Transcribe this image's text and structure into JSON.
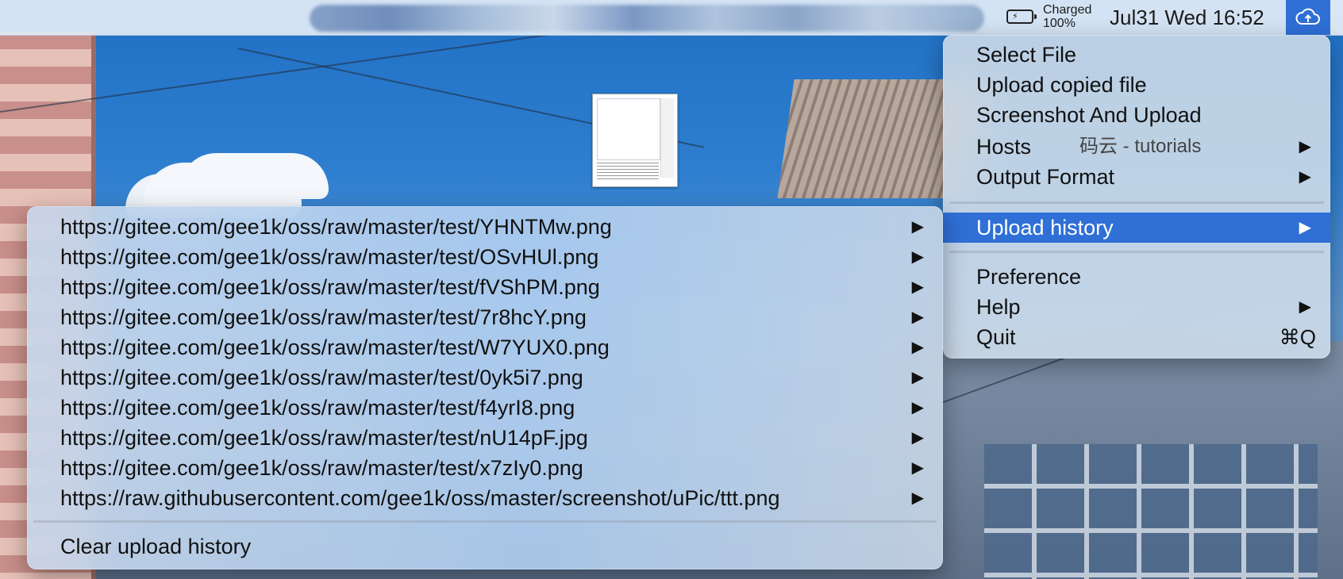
{
  "menubar": {
    "battery_status": "Charged",
    "battery_percent": "100%",
    "clock": "Jul31 Wed 16:52",
    "tray_icon": "cloud-upload-icon"
  },
  "main_menu": {
    "items": [
      {
        "label": "Select File"
      },
      {
        "label": "Upload copied file"
      },
      {
        "label": "Screenshot And Upload"
      },
      {
        "label": "Hosts",
        "value": "码云 - tutorials",
        "has_submenu": true
      },
      {
        "label": "Output Format",
        "has_submenu": true
      },
      {
        "label": "Upload history",
        "has_submenu": true,
        "highlighted": true
      },
      {
        "label": "Preference"
      },
      {
        "label": "Help",
        "has_submenu": true
      },
      {
        "label": "Quit",
        "shortcut": "⌘Q"
      }
    ],
    "arrow": "▶"
  },
  "history_menu": {
    "items": [
      "https://gitee.com/gee1k/oss/raw/master/test/YHNTMw.png",
      "https://gitee.com/gee1k/oss/raw/master/test/OSvHUl.png",
      "https://gitee.com/gee1k/oss/raw/master/test/fVShPM.png",
      "https://gitee.com/gee1k/oss/raw/master/test/7r8hcY.png",
      "https://gitee.com/gee1k/oss/raw/master/test/W7YUX0.png",
      "https://gitee.com/gee1k/oss/raw/master/test/0yk5i7.png",
      "https://gitee.com/gee1k/oss/raw/master/test/f4yrI8.png",
      "https://gitee.com/gee1k/oss/raw/master/test/nU14pF.jpg",
      "https://gitee.com/gee1k/oss/raw/master/test/x7zIy0.png",
      "https://raw.githubusercontent.com/gee1k/oss/master/screenshot/uPic/ttt.png"
    ],
    "clear_label": "Clear upload history"
  },
  "colors": {
    "highlight": "#2f6fd6",
    "menu_bg": "#cddae8"
  }
}
